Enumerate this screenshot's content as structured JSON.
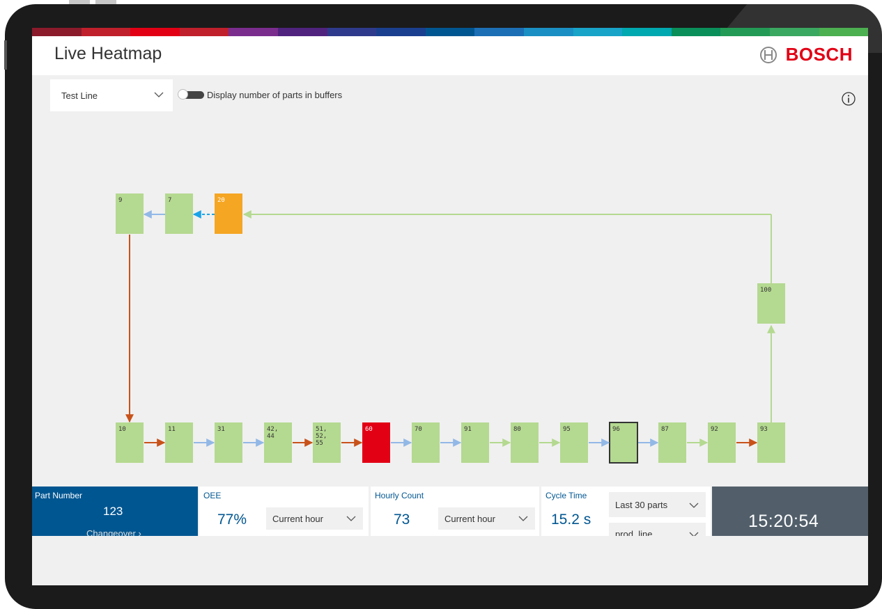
{
  "app": {
    "title": "Live Heatmap",
    "brand": "BOSCH"
  },
  "controls": {
    "line_select": "Test Line",
    "toggle_label": "Display number of parts in buffers",
    "toggle_on": false
  },
  "colors": {
    "station_ok": "#b4d990",
    "station_warning": "#f5a623",
    "station_error": "#e20015",
    "arrow_blue": "#92b8e6",
    "arrow_green": "#b4d990",
    "arrow_orange": "#c8521a",
    "arrow_dashed": "#1aa3e8",
    "brand_blue": "#005691",
    "brand_red": "#e20015"
  },
  "heatmap": {
    "top_stations": [
      {
        "label": "9",
        "status": "ok"
      },
      {
        "label": "7",
        "status": "ok"
      },
      {
        "label": "20",
        "status": "warning"
      }
    ],
    "right_station": {
      "label": "100",
      "status": "ok"
    },
    "bottom_stations": [
      {
        "label": "10",
        "status": "ok"
      },
      {
        "label": "11",
        "status": "ok"
      },
      {
        "label": "31",
        "status": "ok"
      },
      {
        "label": "42,\n44",
        "status": "ok"
      },
      {
        "label": "51,\n52,\n55",
        "status": "ok"
      },
      {
        "label": "60",
        "status": "error"
      },
      {
        "label": "70",
        "status": "ok"
      },
      {
        "label": "91",
        "status": "ok"
      },
      {
        "label": "80",
        "status": "ok"
      },
      {
        "label": "95",
        "status": "ok"
      },
      {
        "label": "96",
        "status": "ok",
        "selected": true
      },
      {
        "label": "87",
        "status": "ok"
      },
      {
        "label": "92",
        "status": "ok"
      },
      {
        "label": "93",
        "status": "ok"
      }
    ],
    "bottom_arrows": [
      "orange",
      "blue",
      "blue",
      "orange",
      "orange",
      "blue",
      "blue",
      "green",
      "green",
      "blue",
      "blue",
      "green",
      "orange"
    ],
    "top_arrows": [
      "blue",
      "dashed"
    ]
  },
  "footer": {
    "part_number": {
      "title": "Part Number",
      "value": "123",
      "link": "Changeover ›"
    },
    "oee": {
      "title": "OEE",
      "value": "77%",
      "period": "Current hour"
    },
    "hourly_count": {
      "title": "Hourly Count",
      "value": "73",
      "period": "Current hour"
    },
    "cycle_time": {
      "title": "Cycle Time",
      "value": "15.2 s",
      "range": "Last 30 parts",
      "source": "prod_line"
    },
    "clock": "15:20:54"
  }
}
